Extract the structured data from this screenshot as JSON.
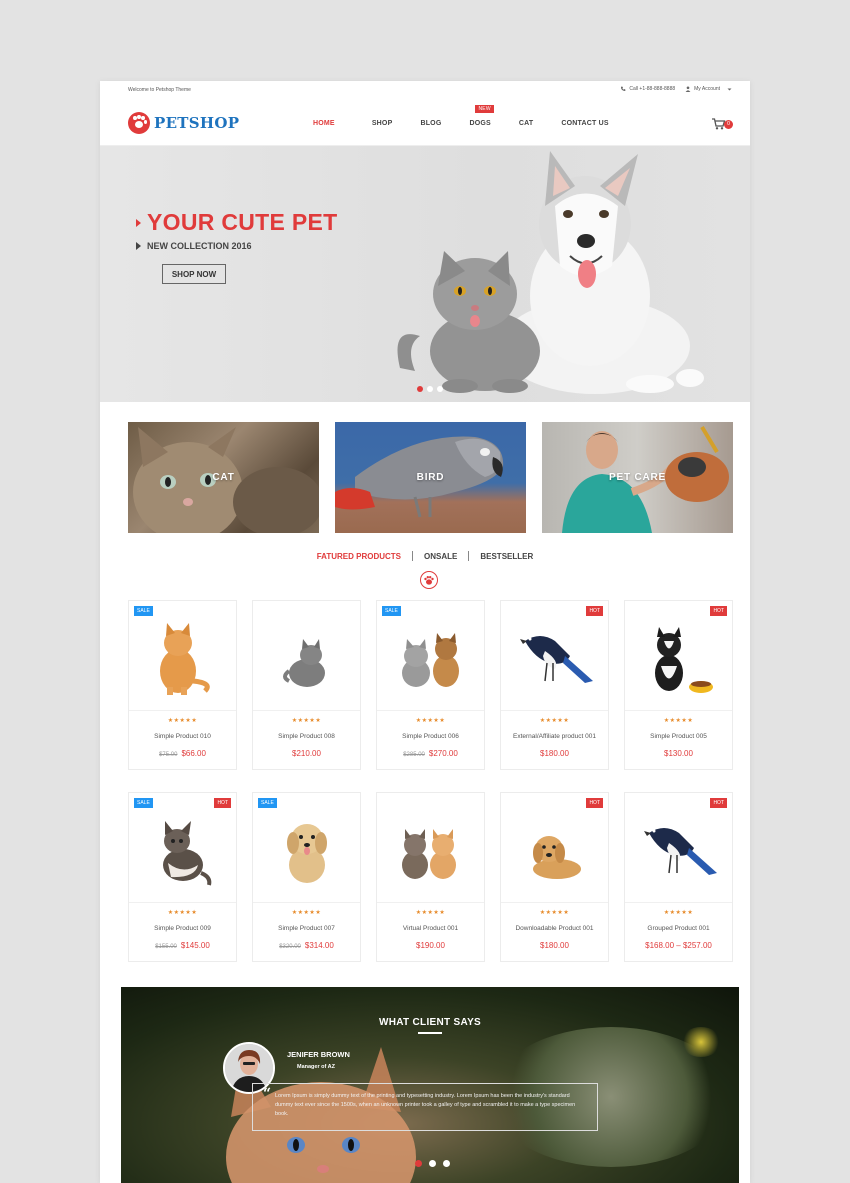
{
  "topbar": {
    "welcome": "Welcome to Petshop Theme",
    "phone": "Call +1-88-888-8888",
    "account": "My Account"
  },
  "header": {
    "logo_text": "PETSHOP",
    "nav": [
      {
        "label": "HOME",
        "active": true
      },
      {
        "label": "SHOP"
      },
      {
        "label": "BLOG"
      },
      {
        "label": "DOGS",
        "badge": "NEW"
      },
      {
        "label": "CAT"
      },
      {
        "label": "CONTACT US"
      }
    ],
    "cart_count": "0"
  },
  "hero": {
    "title": "YOUR CUTE PET",
    "subtitle": "NEW COLLECTION 2016",
    "button": "SHOP NOW",
    "slide_count": 3,
    "active_slide": 1
  },
  "categories": [
    {
      "label": "CAT"
    },
    {
      "label": "BIRD"
    },
    {
      "label": "PET CARE"
    }
  ],
  "tabs": [
    {
      "label": "FATURED PRODUCTS",
      "active": true
    },
    {
      "label": "ONSALE"
    },
    {
      "label": "BESTSELLER"
    }
  ],
  "products": [
    {
      "name": "Simple Product 010",
      "old_price": "$75.00",
      "price": "$66.00",
      "sale": "SALE",
      "hot": "",
      "img": "orange-cat",
      "rating": "★★★★★"
    },
    {
      "name": "Simple Product 008",
      "old_price": "",
      "price": "$210.00",
      "sale": "",
      "hot": "",
      "img": "grey-cat",
      "rating": "★★★★★"
    },
    {
      "name": "Simple Product 006",
      "old_price": "$285.00",
      "price": "$270.00",
      "sale": "SALE",
      "hot": "",
      "img": "cat-dog",
      "rating": "★★★★★"
    },
    {
      "name": "External/Affiliate product 001",
      "old_price": "",
      "price": "$180.00",
      "sale": "",
      "hot": "HOT",
      "img": "magpie",
      "rating": "★★★★★"
    },
    {
      "name": "Simple Product 005",
      "old_price": "",
      "price": "$130.00",
      "sale": "",
      "hot": "HOT",
      "img": "bw-dog",
      "rating": "★★★★★"
    },
    {
      "name": "Simple Product 009",
      "old_price": "$155.00",
      "price": "$145.00",
      "sale": "SALE",
      "hot": "HOT",
      "img": "kitten",
      "rating": "★★★★★"
    },
    {
      "name": "Simple Product 007",
      "old_price": "$320.00",
      "price": "$314.00",
      "sale": "SALE",
      "hot": "",
      "img": "puppy",
      "rating": "★★★★★"
    },
    {
      "name": "Virtual Product 001",
      "old_price": "",
      "price": "$190.00",
      "sale": "",
      "hot": "",
      "img": "two-kittens",
      "rating": "★★★★★"
    },
    {
      "name": "Downloadable Product 001",
      "old_price": "",
      "price": "$180.00",
      "sale": "",
      "hot": "HOT",
      "img": "golden-puppy",
      "rating": "★★★★★"
    },
    {
      "name": "Grouped Product 001",
      "old_price": "",
      "price": "$168.00  –  $257.00",
      "sale": "",
      "hot": "HOT",
      "img": "magpie",
      "rating": "★★★★★"
    }
  ],
  "testimonial": {
    "heading": "WHAT CLIENT SAYS",
    "name": "JENIFER BROWN",
    "role": "Manager of AZ",
    "quote": "Lorem Ipsum is simply dummy text of the printing and typesetting industry. Lorem Ipsum has been the industry's standard dummy text ever since the 1500s, when an unknown printer took a galley of type and scrambled it to make a type specimen book.",
    "slide_count": 3,
    "active_slide": 1
  },
  "colors": {
    "accent": "#e03b3b",
    "logo_blue": "#1e73be",
    "sale_blue": "#2196f3",
    "star": "#e78b2b"
  }
}
